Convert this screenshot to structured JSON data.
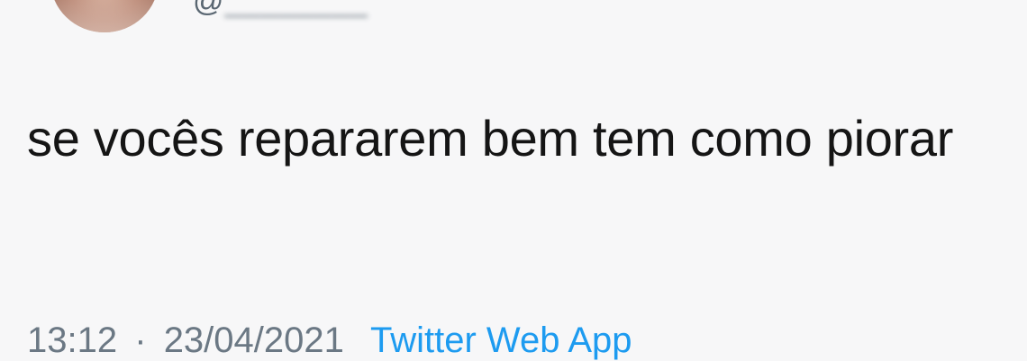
{
  "tweet": {
    "handle": "@",
    "handle_obscured": "________",
    "text": "se vocês repararem bem tem como piorar",
    "time": "13:12",
    "separator": "·",
    "date": "23/04/2021",
    "source": "Twitter Web App"
  },
  "colors": {
    "background": "#f7f7f8",
    "text": "#151515",
    "meta": "#6b7884",
    "link": "#1d9bf0"
  }
}
